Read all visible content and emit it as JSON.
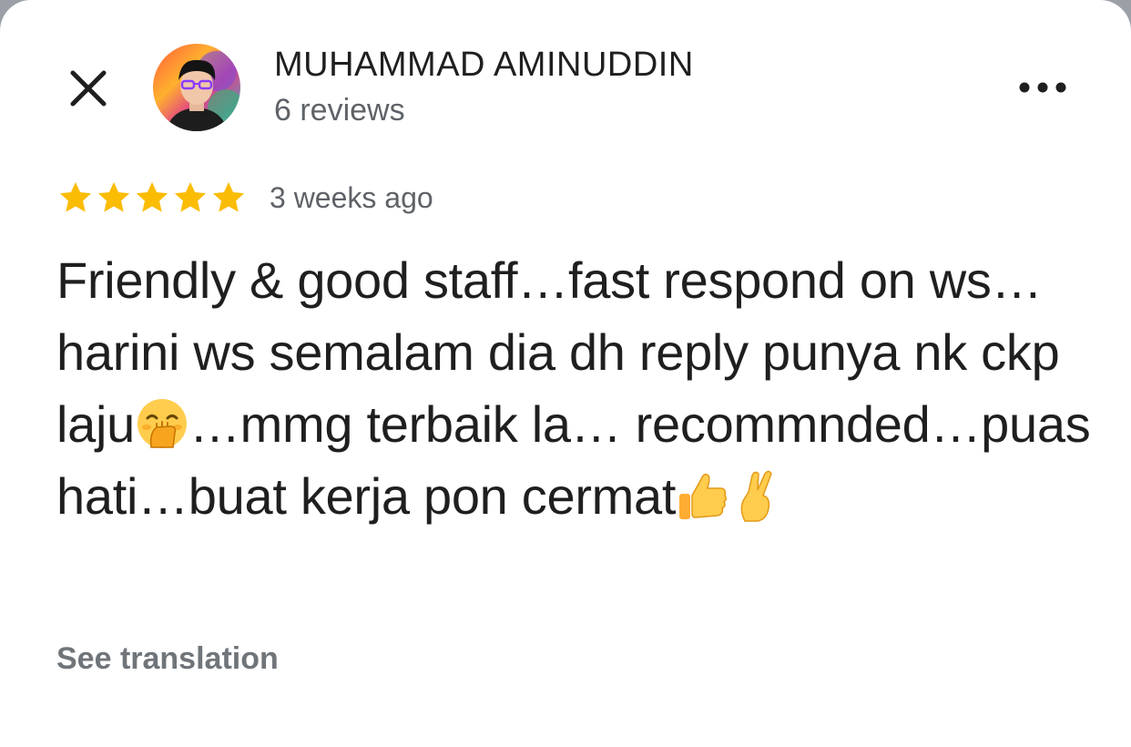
{
  "header": {
    "close_icon": "close-icon",
    "author_name": "MUHAMMAD AMINUDDIN",
    "review_count": "6 reviews",
    "more_icon": "more-horizontal-icon"
  },
  "review": {
    "rating": 5,
    "rating_max": 5,
    "star_color": "#fbbc04",
    "time_ago": "3 weeks ago",
    "text_part1": "Friendly & good staff…fast respond on ws…harini ws semalam dia dh reply punya nk ckp laju",
    "emoji1": "hand-over-mouth-emoji",
    "text_part2": "…mmg terbaik la… recommnded…puas hati…buat kerja pon cermat",
    "emoji2": "thumbs-up-emoji",
    "emoji3": "crossed-fingers-emoji"
  },
  "footer": {
    "see_translation": "See translation"
  },
  "colors": {
    "text_primary": "#1f1f1f",
    "text_secondary": "#5f6368",
    "link_grey": "#70757a"
  }
}
